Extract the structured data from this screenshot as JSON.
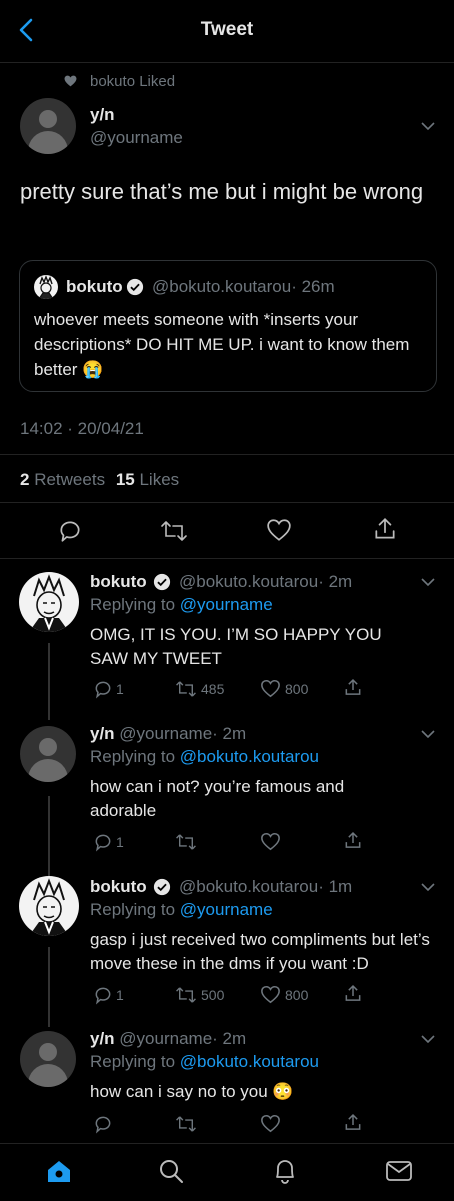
{
  "header": {
    "title": "Tweet"
  },
  "liked_by": "bokuto Liked",
  "main_tweet": {
    "display_name": "y/n",
    "handle": "@yourname",
    "text": "pretty sure that’s me but i might be wrong",
    "timestamp": "14:02 · 20/04/21",
    "retweets_count": "2",
    "retweets_label": "Retweets",
    "likes_count": "15",
    "likes_label": "Likes"
  },
  "quoted_tweet": {
    "display_name": "bokuto",
    "handle": "@bokuto.koutarou",
    "time": "· 26m",
    "text": "whoever meets someone with *inserts your descriptions* DO HIT ME UP. i want to know them better 😭"
  },
  "replies": [
    {
      "display_name": "bokuto",
      "handle": "@bokuto.koutarou",
      "time": "· 2m",
      "replying_prefix": "Replying to",
      "replying_to": "@yourname",
      "text": "OMG, IT IS YOU. I’M SO HAPPY YOU SAW MY TWEET",
      "replies": "1",
      "retweets": "485",
      "likes": "800"
    },
    {
      "display_name": "y/n",
      "handle": "@yourname",
      "time": "· 2m",
      "replying_prefix": "Replying to",
      "replying_to": "@bokuto.koutarou",
      "text": "how can i not? you’re famous and adorable",
      "replies": "1",
      "retweets": "",
      "likes": ""
    },
    {
      "display_name": "bokuto",
      "handle": "@bokuto.koutarou",
      "time": "· 1m",
      "replying_prefix": "Replying to",
      "replying_to": "@yourname",
      "text": "gasp i just received two compliments but let’s move these in the dms if you want :D",
      "replies": "1",
      "retweets": "500",
      "likes": "800"
    },
    {
      "display_name": "y/n",
      "handle": "@yourname",
      "time": "· 2m",
      "replying_prefix": "Replying to",
      "replying_to": "@bokuto.koutarou",
      "text": "how can i say no to you 😳"
    }
  ],
  "colors": {
    "accent": "#1d9bf0",
    "muted": "#6e767d",
    "background": "#000000"
  }
}
